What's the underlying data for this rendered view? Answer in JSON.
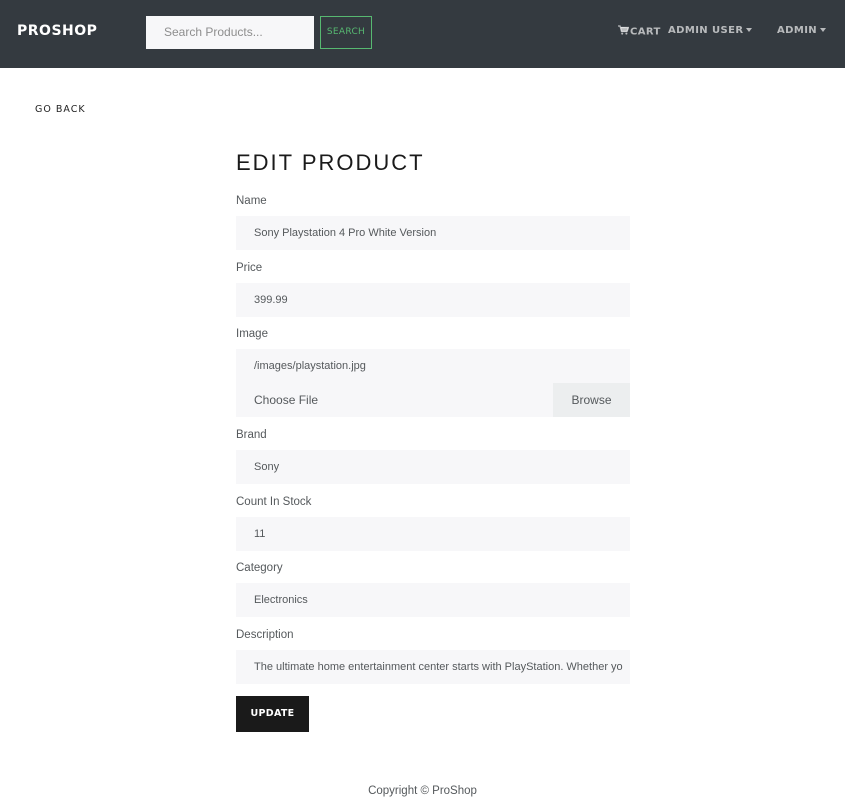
{
  "navbar": {
    "brand": "PROSHOP",
    "search_placeholder": "Search Products...",
    "search_button": "SEARCH",
    "cart_label": "CART",
    "user_menu": "ADMIN USER",
    "admin_menu": "ADMIN",
    "background": "#343a40",
    "accent": "#57b871"
  },
  "page": {
    "go_back": "GO BACK",
    "title": "EDIT PRODUCT"
  },
  "form": {
    "name_label": "Name",
    "name_value": "Sony Playstation 4 Pro White Version",
    "price_label": "Price",
    "price_value": "399.99",
    "image_label": "Image",
    "image_value": "/images/playstation.jpg",
    "file_label": "Choose File",
    "browse_label": "Browse",
    "brand_label": "Brand",
    "brand_value": "Sony",
    "stock_label": "Count In Stock",
    "stock_value": "11",
    "category_label": "Category",
    "category_value": "Electronics",
    "description_label": "Description",
    "description_value": "The ultimate home entertainment center starts with PlayStation. Whether yo",
    "update_button": "UPDATE"
  },
  "footer": {
    "copyright": "Copyright © ProShop"
  }
}
